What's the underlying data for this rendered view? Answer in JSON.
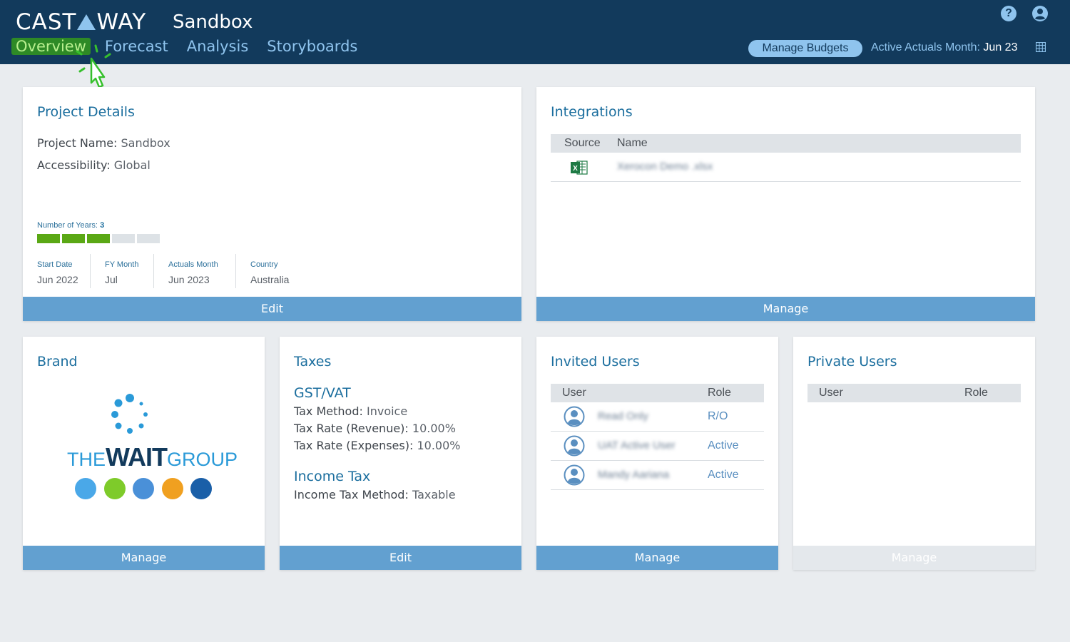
{
  "header": {
    "logo_left": "CAST",
    "logo_right": "WAY",
    "project_title": "Sandbox",
    "nav": [
      "Overview",
      "Forecast",
      "Analysis",
      "Storyboards"
    ],
    "manage_budgets": "Manage Budgets",
    "actuals_label": "Active Actuals Month:",
    "actuals_value": "Jun 23",
    "help": "?",
    "colors": {
      "bar": "#123a5c",
      "accent": "#8fc4ee",
      "active_nav": "#2e8a26"
    },
    "icons": [
      "help-icon",
      "user-icon",
      "calendar-icon",
      "cursor-icon"
    ]
  },
  "project_details": {
    "title": "Project Details",
    "name_label": "Project Name:",
    "name_value": "Sandbox",
    "access_label": "Accessibility:",
    "access_value": "Global",
    "years_label": "Number of Years:",
    "years_value": "3",
    "years_total_segments": 5,
    "years_filled_segments": 3,
    "start_label": "Start Date",
    "start_value": "Jun 2022",
    "fy_label": "FY Month",
    "fy_value": "Jul",
    "actuals_label": "Actuals Month",
    "actuals_value": "Jun 2023",
    "country_label": "Country",
    "country_value": "Australia",
    "button": "Edit"
  },
  "integrations": {
    "title": "Integrations",
    "col_source": "Source",
    "col_name": "Name",
    "rows": [
      {
        "icon": "excel-icon",
        "name": "Xerocon Demo .xlsx"
      }
    ],
    "button": "Manage"
  },
  "brand": {
    "title": "Brand",
    "logo_the": "THE",
    "logo_wait": "WAIT",
    "logo_group": "GROUP",
    "dot_colors": [
      "#4aa8e8",
      "#7ecb2a",
      "#4a90d8",
      "#f0a020",
      "#1a5fa8"
    ],
    "button": "Manage"
  },
  "taxes": {
    "title": "Taxes",
    "gst_heading": "GST/VAT",
    "method_label": "Tax Method:",
    "method_value": "Invoice",
    "rev_label": "Tax Rate (Revenue):",
    "rev_value": "10.00%",
    "exp_label": "Tax Rate (Expenses):",
    "exp_value": "10.00%",
    "income_heading": "Income Tax",
    "income_label": "Income Tax Method:",
    "income_value": "Taxable",
    "button": "Edit"
  },
  "invited_users": {
    "title": "Invited Users",
    "col_user": "User",
    "col_role": "Role",
    "rows": [
      {
        "name": "Read Only",
        "role": "R/O"
      },
      {
        "name": "UAT Active User",
        "role": "Active"
      },
      {
        "name": "Mandy Aariana",
        "role": "Active"
      }
    ],
    "button": "Manage"
  },
  "private_users": {
    "title": "Private Users",
    "col_user": "User",
    "col_role": "Role",
    "button": "Manage"
  }
}
